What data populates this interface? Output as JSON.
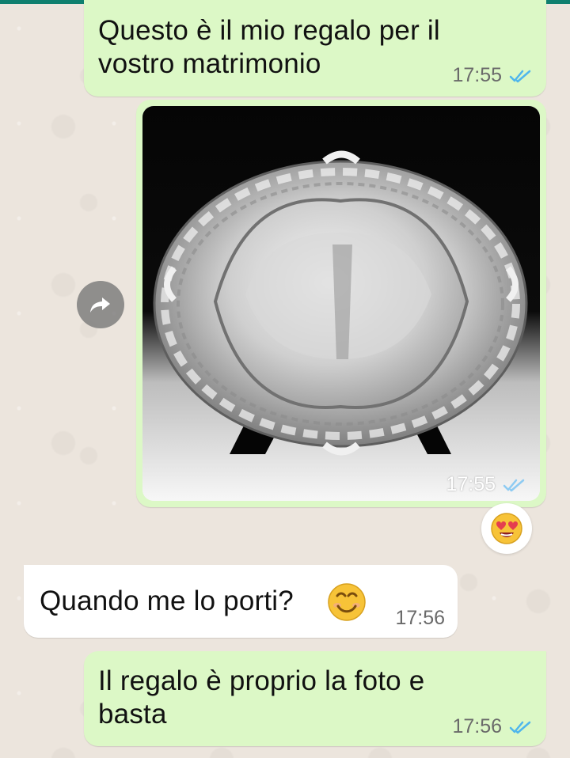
{
  "colors": {
    "outgoing_bubble": "#dcf8c6",
    "incoming_bubble": "#ffffff",
    "read_ticks": "#4fb6ec",
    "top_bar": "#0f7f6f"
  },
  "messages": [
    {
      "direction": "outgoing",
      "lines": [
        "Questo è il mio regalo per il",
        "vostro matrimonio"
      ],
      "time": "17:55",
      "status": "read-double-check-icon"
    },
    {
      "direction": "outgoing",
      "type": "image",
      "image_description": "silver-tray-photo",
      "time": "17:55",
      "status": "read-double-check-icon",
      "reaction": "heart-eyes-emoji",
      "forward_icon": "share-arrow-icon"
    },
    {
      "direction": "incoming",
      "text": "Quando me lo porti?",
      "emoji": "smiling-face-emoji",
      "time": "17:56"
    },
    {
      "direction": "outgoing",
      "lines": [
        "Il regalo è proprio la foto e",
        "basta"
      ],
      "time": "17:56",
      "status": "read-double-check-icon"
    }
  ]
}
